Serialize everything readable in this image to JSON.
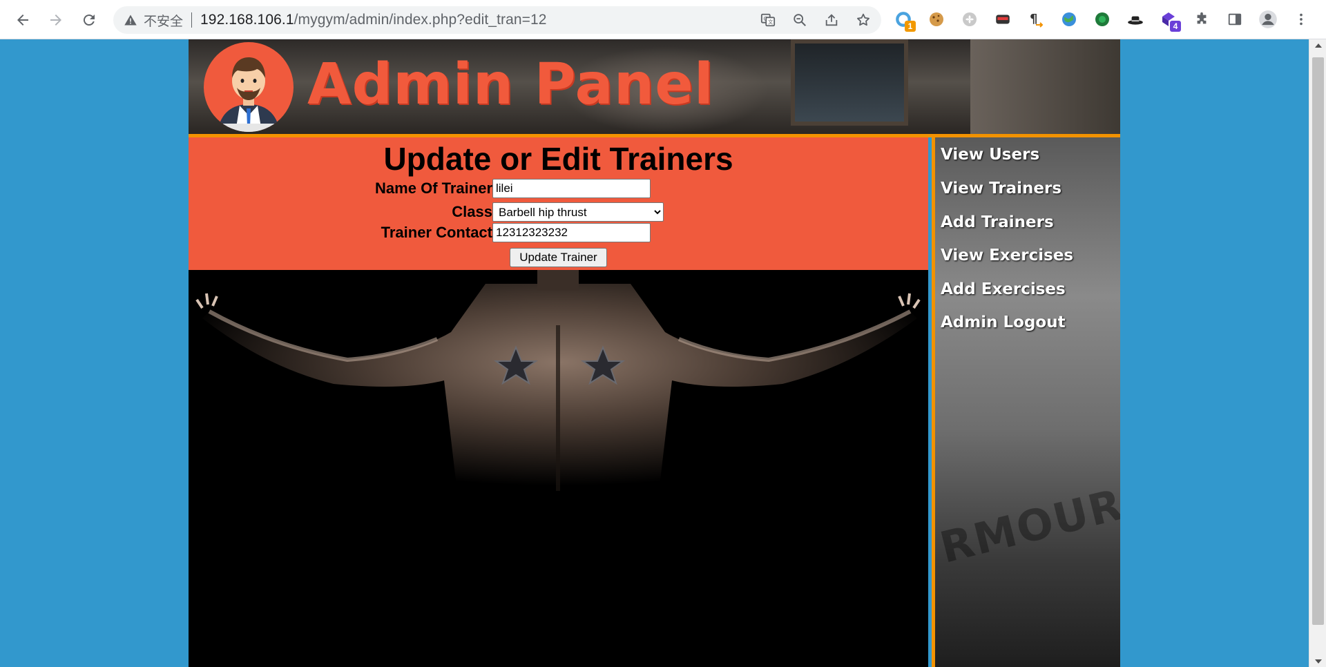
{
  "browser": {
    "security_label": "不安全",
    "url_host": "192.168.106.1",
    "url_path": "/mygym/admin/index.php?edit_tran=12",
    "extensions": [
      {
        "icon": "ring-icon",
        "badge": "1",
        "badge_color": "#f29900"
      },
      {
        "icon": "cookie-icon"
      },
      {
        "icon": "clover-icon"
      },
      {
        "icon": "mask-icon"
      },
      {
        "icon": "pilcrow-arrow-icon"
      },
      {
        "icon": "globe-icon"
      },
      {
        "icon": "green-orb-icon"
      },
      {
        "icon": "hat-icon"
      },
      {
        "icon": "purple-cube-icon",
        "badge": "4",
        "badge_color": "#6a3fd8"
      },
      {
        "icon": "puzzle-icon"
      },
      {
        "icon": "side-panel-icon"
      },
      {
        "icon": "profile-icon"
      },
      {
        "icon": "kebab-menu-icon"
      }
    ]
  },
  "header": {
    "title": "Admin Panel"
  },
  "form": {
    "title": "Update or Edit Trainers",
    "name_label": "Name Of Trainer",
    "name_value": "lilei",
    "class_label": "Class",
    "class_selected": "Barbell hip thrust",
    "contact_label": "Trainer Contact",
    "contact_value": "12312323232",
    "submit_label": "Update Trainer"
  },
  "sidebar": {
    "items": [
      {
        "label": "View Users"
      },
      {
        "label": "View Trainers"
      },
      {
        "label": "Add Trainers"
      },
      {
        "label": "View Exercises"
      },
      {
        "label": "Add Exercises"
      },
      {
        "label": "Admin Logout"
      }
    ],
    "background_text": "RMOUR"
  },
  "colors": {
    "page_bg": "#3298cd",
    "accent_orange": "#f29200",
    "form_bg": "#f05a3d"
  }
}
